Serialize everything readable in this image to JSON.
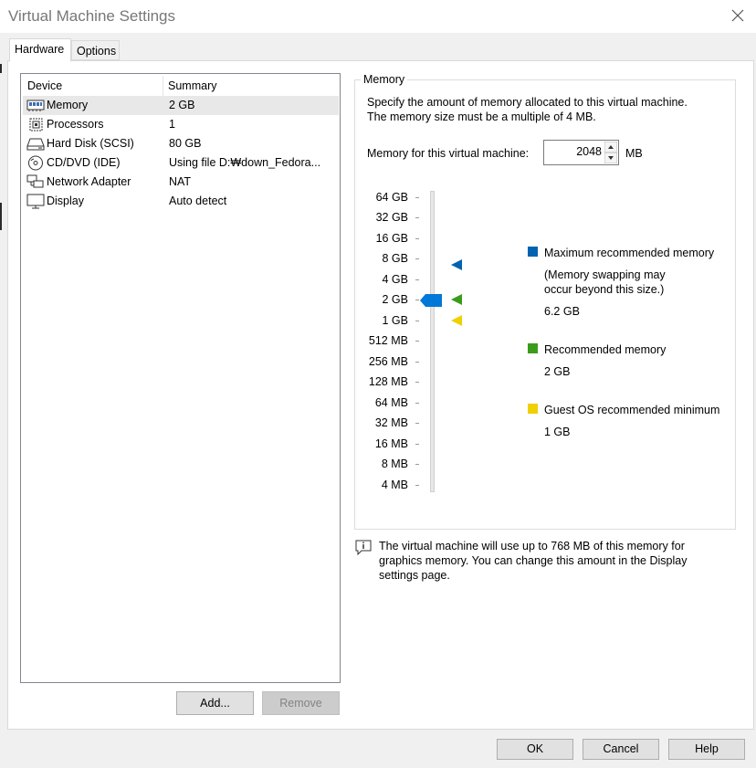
{
  "window": {
    "title": "Virtual Machine Settings"
  },
  "tabs": [
    {
      "label": "Hardware",
      "active": true
    },
    {
      "label": "Options",
      "active": false
    }
  ],
  "device_list": {
    "columns": [
      "Device",
      "Summary"
    ],
    "rows": [
      {
        "icon": "memory-icon",
        "device": "Memory",
        "summary": "2 GB",
        "selected": true
      },
      {
        "icon": "processor-icon",
        "device": "Processors",
        "summary": "1"
      },
      {
        "icon": "hard-disk-icon",
        "device": "Hard Disk (SCSI)",
        "summary": "80 GB"
      },
      {
        "icon": "cd-dvd-icon",
        "device": "CD/DVD (IDE)",
        "summary": "Using file D:₩down_Fedora..."
      },
      {
        "icon": "network-adapter-icon",
        "device": "Network Adapter",
        "summary": "NAT"
      },
      {
        "icon": "display-icon",
        "device": "Display",
        "summary": "Auto detect"
      }
    ]
  },
  "buttons": {
    "add": "Add...",
    "remove": "Remove",
    "ok": "OK",
    "cancel": "Cancel",
    "help": "Help"
  },
  "memory": {
    "group_label": "Memory",
    "description_line1": "Specify the amount of memory allocated to this virtual machine.",
    "description_line2": "The memory size must be a multiple of 4 MB.",
    "field_label": "Memory for this virtual machine:",
    "value": "2048",
    "unit": "MB",
    "scale_labels": [
      "64 GB",
      "32 GB",
      "16 GB",
      "8 GB",
      "4 GB",
      "2 GB",
      "1 GB",
      "512 MB",
      "256 MB",
      "128 MB",
      "64 MB",
      "32 MB",
      "16 MB",
      "8 MB",
      "4 MB"
    ],
    "slider_value": "2 GB",
    "legend": {
      "max": {
        "color": "#0063b1",
        "label": "Maximum recommended memory",
        "note_line1": "(Memory swapping may",
        "note_line2": "occur beyond this size.)",
        "value": "6.2 GB"
      },
      "recommended": {
        "color": "#3a9c1a",
        "label": "Recommended memory",
        "value": "2 GB"
      },
      "guest_min": {
        "color": "#f0d000",
        "label": "Guest OS recommended minimum",
        "value": "1 GB"
      }
    }
  },
  "info": {
    "line1": "The virtual machine will use up to 768 MB of this memory for",
    "line2": "graphics memory. You can change this amount in the Display",
    "line3": "settings page."
  }
}
